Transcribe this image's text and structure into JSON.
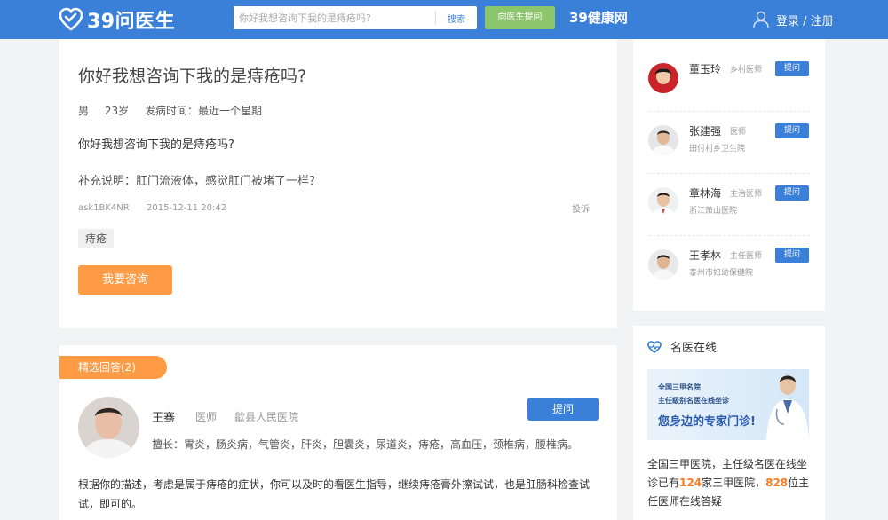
{
  "header": {
    "logo_text": "39问医生",
    "search_placeholder": "你好我想咨询下我的是痔疮吗?",
    "search_button": "搜索",
    "ask_doctor_button": "向医生提问",
    "brand": "39健康网",
    "login": "登录 / 注册"
  },
  "question": {
    "title": "你好我想咨询下我的是痔疮吗?",
    "gender": "男",
    "age": "23岁",
    "onset": "发病时间：最近一个星期",
    "body": "你好我想咨询下我的是痔疮吗?",
    "supplement": "补充说明：肛门流液体，感觉肛门被堵了一样？",
    "user_id": "ask1BK4NR",
    "time": "2015-12-11 20:42",
    "report": "投诉",
    "tag": "痔疮",
    "consult_button": "我要咨询"
  },
  "answers": {
    "tab_label": "精选回答(2)",
    "items": [
      {
        "name": "王骞",
        "title": "医师",
        "hospital": "歙县人民医院",
        "ask_button": "提问",
        "specialty": "擅长：胃炎，肠炎病，气管炎，肝炎，胆囊炎，尿道炎，痔疮，高血压，颈椎病，腰椎病。",
        "text": "根据你的描述，考虑是属于痔疮的症状，你可以及时的看医生指导，继续痔疮膏外擦试试，也是肛肠科检查试试，即可的。"
      }
    ]
  },
  "doctors": [
    {
      "name": "董玉玲",
      "title": "乡村医师",
      "hospital": "",
      "ask": "提问"
    },
    {
      "name": "张建强",
      "title": "医师",
      "hospital": "田付村乡卫生院",
      "ask": "提问"
    },
    {
      "name": "章林海",
      "title": "主治医师",
      "hospital": "浙江萧山医院",
      "ask": "提问"
    },
    {
      "name": "王孝林",
      "title": "主任医师",
      "hospital": "泰州市妇幼保健院",
      "ask": "提问"
    }
  ],
  "famous": {
    "title": "名医在线",
    "banner_line1": "全国三甲名院",
    "banner_line2": "主任级别名医在线坐诊",
    "banner_line3": "您身边的专家门诊!",
    "desc_part1": "全国三甲医院，主任级名医在线坐诊已有",
    "num_hospitals": "124",
    "desc_part2": "家三甲医院，",
    "num_doctors": "828",
    "desc_part3": "位主任医师在线答疑"
  },
  "colors": {
    "header_blue": "#3a7fd8",
    "accent_orange": "#ff9b45",
    "green": "#8cc56b"
  }
}
